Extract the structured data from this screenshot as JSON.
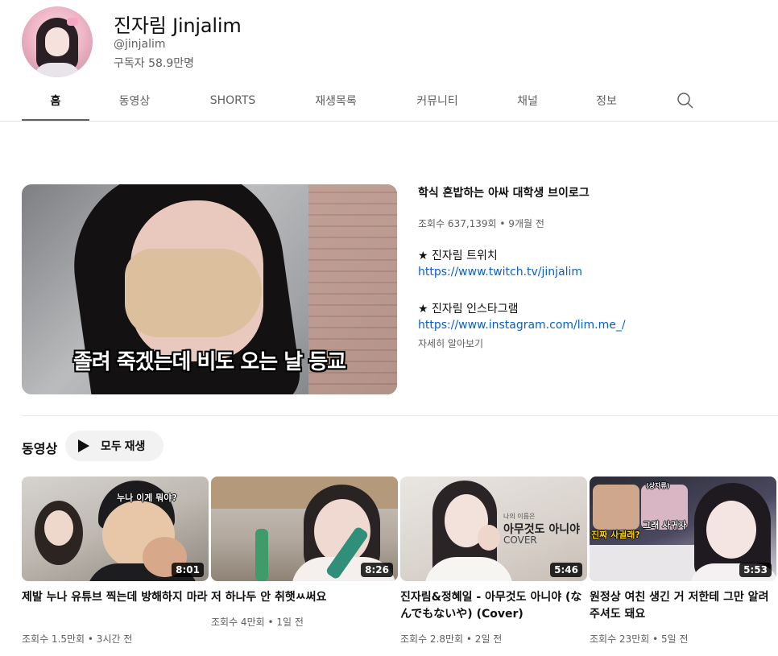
{
  "channel": {
    "name": "진자림 Jinjalim",
    "handle": "@jinjalim",
    "subscribers": "구독자 58.9만명"
  },
  "tabs": [
    {
      "label": "홈",
      "active": true
    },
    {
      "label": "동영상"
    },
    {
      "label": "SHORTS"
    },
    {
      "label": "재생목록"
    },
    {
      "label": "커뮤니티"
    },
    {
      "label": "채널"
    },
    {
      "label": "정보"
    }
  ],
  "featured": {
    "thumbnail_caption": "졸려 죽겠는데 비도 오는 날 등교",
    "title": "학식 혼밥하는 아싸 대학생 브이로그",
    "meta": "조회수 637,139회 • 9개월 전",
    "line1": "★ 진자림 트위치",
    "link1": "https://www.twitch.tv/jinjalim",
    "line2": "★ 진자림 인스타그램",
    "link2": "https://www.instagram.com/lim.me_/",
    "more": "자세히 알아보기"
  },
  "shelf": {
    "title": "동영상",
    "play_all": "모두 재생"
  },
  "videos": [
    {
      "title": "제발 누나 유튜브 찍는데 방해하지 마라",
      "meta": "조회수 1.5만회 • 3시간 전",
      "duration": "8:01",
      "thumb_text": "누나 이게 뭐야?"
    },
    {
      "title": "저 하나두 안 취햇ㅆ써요",
      "meta": "조회수 4만회 • 1일 전",
      "duration": "8:26",
      "thumb_text": ""
    },
    {
      "title": "진자림&정혜일 - 아무것도 아니야 (なんでもないや) (Cover)",
      "meta": "조회수 2.8만회 • 2일 전",
      "duration": "5:46",
      "thumb_text": "아무것도 아니야",
      "thumb_small": "나의 이름은",
      "thumb_cover": "COVER"
    },
    {
      "title": "원정상 여친 생긴 거 저한테 그만 알려 주셔도 돼요",
      "meta": "조회수 23만회 • 5일 전",
      "duration": "5:53",
      "thumb_text": "진짜 사귈래?",
      "thumb_text2": "그래 사귀자",
      "thumb_small": "(상자류)"
    }
  ]
}
